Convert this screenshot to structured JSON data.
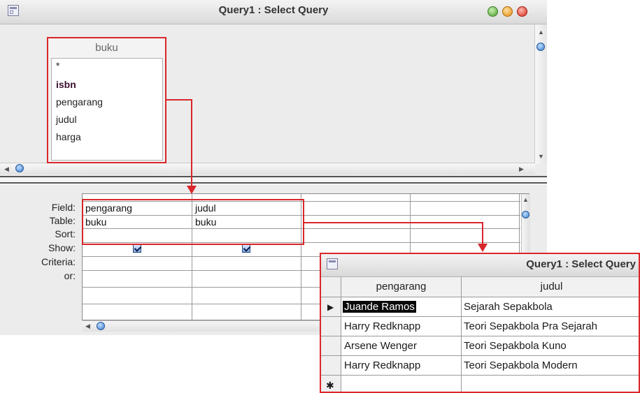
{
  "window": {
    "title": "Query1 : Select Query"
  },
  "table_list": {
    "table_name": "buku",
    "fields": [
      "*",
      "isbn",
      "pengarang",
      "judul",
      "harga"
    ]
  },
  "design_grid": {
    "row_labels": [
      "Field:",
      "Table:",
      "Sort:",
      "Show:",
      "Criteria:",
      "or:"
    ],
    "columns": [
      {
        "field": "pengarang",
        "table": "buku",
        "show": true
      },
      {
        "field": "judul",
        "table": "buku",
        "show": true
      }
    ]
  },
  "result": {
    "title": "Query1 : Select Query",
    "headers": [
      "pengarang",
      "judul"
    ],
    "rows": [
      {
        "pengarang": "Juande Ramos",
        "judul": "Sejarah Sepakbola"
      },
      {
        "pengarang": "Harry Redknapp",
        "judul": "Teori Sepakbola Pra Sejarah"
      },
      {
        "pengarang": "Arsene Wenger",
        "judul": "Teori Sepakbola Kuno"
      },
      {
        "pengarang": "Harry Redknapp",
        "judul": "Teori Sepakbola Modern"
      }
    ],
    "current_row_marker": "▶",
    "new_row_marker": "✱"
  },
  "colors": {
    "highlight": "#d9262a",
    "key_field": "#3a1030"
  }
}
